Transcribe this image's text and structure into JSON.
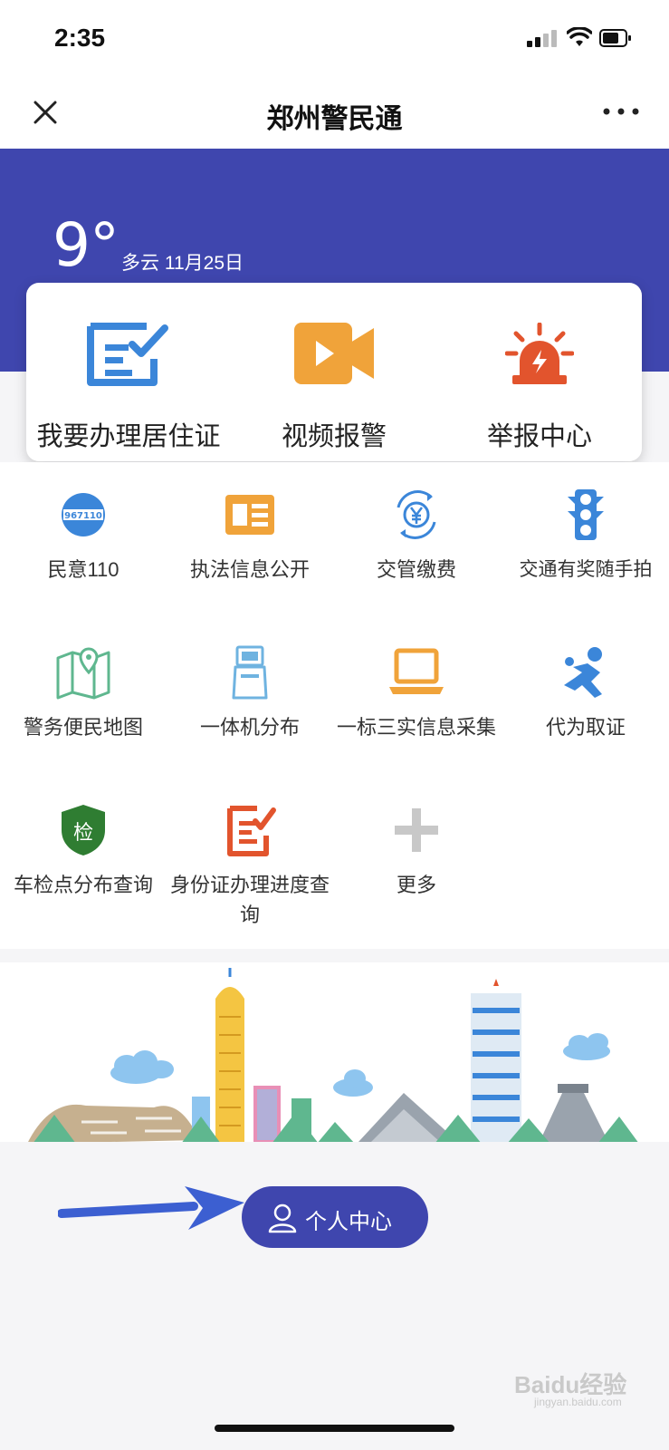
{
  "status_bar": {
    "time": "2:35"
  },
  "nav": {
    "title": "郑州警民通"
  },
  "weather": {
    "temperature": "9°",
    "description": "多云 11月25日"
  },
  "primary_actions": [
    {
      "label": "我要办理居住证",
      "icon": "residence-permit-icon"
    },
    {
      "label": "视频报警",
      "icon": "video-alarm-icon"
    },
    {
      "label": "举报中心",
      "icon": "siren-icon"
    }
  ],
  "grid": [
    {
      "label": "民意110",
      "icon": "967110-badge-icon"
    },
    {
      "label": "执法信息公开",
      "icon": "id-card-icon"
    },
    {
      "label": "交管缴费",
      "icon": "yuan-refresh-icon"
    },
    {
      "label": "交通有奖随手拍",
      "icon": "traffic-light-icon"
    },
    {
      "label": "警务便民地图",
      "icon": "map-pin-icon"
    },
    {
      "label": "一体机分布",
      "icon": "kiosk-icon"
    },
    {
      "label": "一标三实信息采集",
      "icon": "laptop-icon"
    },
    {
      "label": "代为取证",
      "icon": "runner-icon"
    },
    {
      "label": "车检点分布查询",
      "icon": "shield-check-icon"
    },
    {
      "label": "身份证办理进度查询",
      "icon": "form-edit-icon"
    },
    {
      "label": "更多",
      "icon": "plus-icon"
    }
  ],
  "personal_center": {
    "label": "个人中心"
  },
  "watermark": {
    "text": "Baidu经验",
    "sub": "jingyan.baidu.com"
  },
  "colors": {
    "brand": "#3f46ae",
    "blue": "#3b86d9",
    "orange": "#f0a33a",
    "red": "#e2542d",
    "green": "#2f7d32"
  }
}
